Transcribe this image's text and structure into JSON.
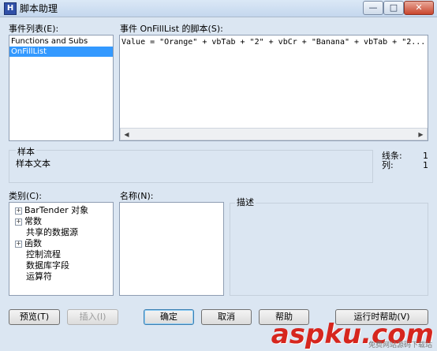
{
  "window": {
    "title": "脚本助理",
    "icon_glyph": "H",
    "controls": {
      "minimize": "—",
      "maximize": "□",
      "close": "✕"
    }
  },
  "events": {
    "label": "事件列表(E):",
    "items": [
      {
        "label": "Functions and Subs",
        "selected": false
      },
      {
        "label": "OnFillList",
        "selected": true
      }
    ]
  },
  "script": {
    "label": "事件 OnFillList 的脚本(S):",
    "code": "Value = \"Orange\" + vbTab + \"2\" + vbCr + \"Banana\" + vbTab + \"2..."
  },
  "sample": {
    "label": "样本",
    "text": "样本文本",
    "line_label": "线条:",
    "line_value": "1",
    "col_label": "列:",
    "col_value": "1"
  },
  "category": {
    "label": "类别(C):",
    "items": [
      {
        "label": "BarTender 对象",
        "expandable": true
      },
      {
        "label": "常数",
        "expandable": true
      },
      {
        "label": "共享的数据源",
        "expandable": false
      },
      {
        "label": "函数",
        "expandable": true
      },
      {
        "label": "控制流程",
        "expandable": false
      },
      {
        "label": "数据库字段",
        "expandable": false
      },
      {
        "label": "运算符",
        "expandable": false
      }
    ]
  },
  "name_list": {
    "label": "名称(N):"
  },
  "description": {
    "label": "描述"
  },
  "buttons": {
    "preview": "预览(T)",
    "insert": "插入(I)",
    "ok": "确定",
    "cancel": "取消",
    "help": "帮助",
    "extra": "运行时帮助(V)"
  },
  "watermark": {
    "main": "aspku.com",
    "sub": "免费网站源码下载站"
  }
}
